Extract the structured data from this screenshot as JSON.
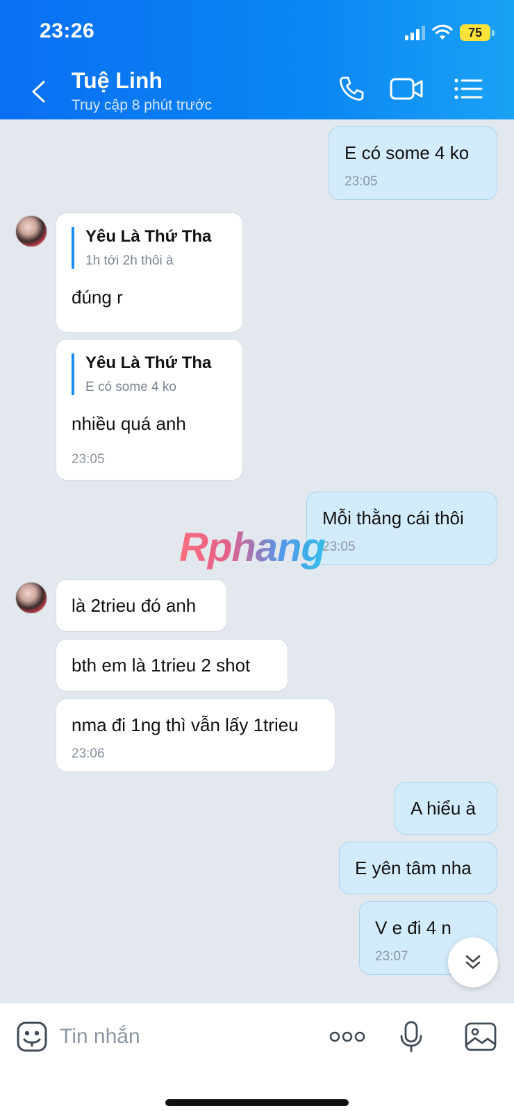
{
  "status_bar": {
    "time": "23:26",
    "battery": "75"
  },
  "header": {
    "contact_name": "Tuệ Linh",
    "contact_status": "Truy cập 8 phút trước"
  },
  "messages": [
    {
      "dir": "out",
      "text": "E có some 4 ko",
      "time": "23:05"
    },
    {
      "dir": "in",
      "quote_title": "Yêu Là Thứ Tha",
      "quote_text": "1h tới 2h thôi à",
      "text": "đúng r"
    },
    {
      "dir": "in",
      "quote_title": "Yêu Là Thứ Tha",
      "quote_text": "E có some 4 ko",
      "text": "nhiều quá anh",
      "time": "23:05"
    },
    {
      "dir": "out",
      "text": "Mỗi thằng cái thôi",
      "time": "23:05"
    },
    {
      "dir": "in",
      "text": "là 2trieu đó anh"
    },
    {
      "dir": "in",
      "text": "bth em là 1trieu 2 shot"
    },
    {
      "dir": "in",
      "text": "nma đi 1ng thì vẫn lấy 1trieu",
      "time": "23:06"
    },
    {
      "dir": "out",
      "text": "A hiểu à"
    },
    {
      "dir": "out",
      "text": "E yên tâm nha"
    },
    {
      "dir": "out",
      "text": "V e đi 4 n",
      "time": "23:07"
    }
  ],
  "watermark": "Rphang",
  "input": {
    "placeholder": "Tin nhắn"
  },
  "icons": {
    "back": "chevron-left-icon",
    "call": "phone-icon",
    "video": "video-camera-icon",
    "menu": "list-menu-icon",
    "emoji": "sticker-icon",
    "more": "more-dots-icon",
    "mic": "microphone-icon",
    "image": "image-icon",
    "scroll": "double-chevron-down-icon"
  },
  "colors": {
    "header_start": "#0a6ff3",
    "header_end": "#1aa2f5",
    "outgoing_bubble": "#d3ecfb",
    "incoming_bubble": "#ffffff",
    "chat_background": "#e3e8ef",
    "quote_bar": "#1a8cf6"
  }
}
